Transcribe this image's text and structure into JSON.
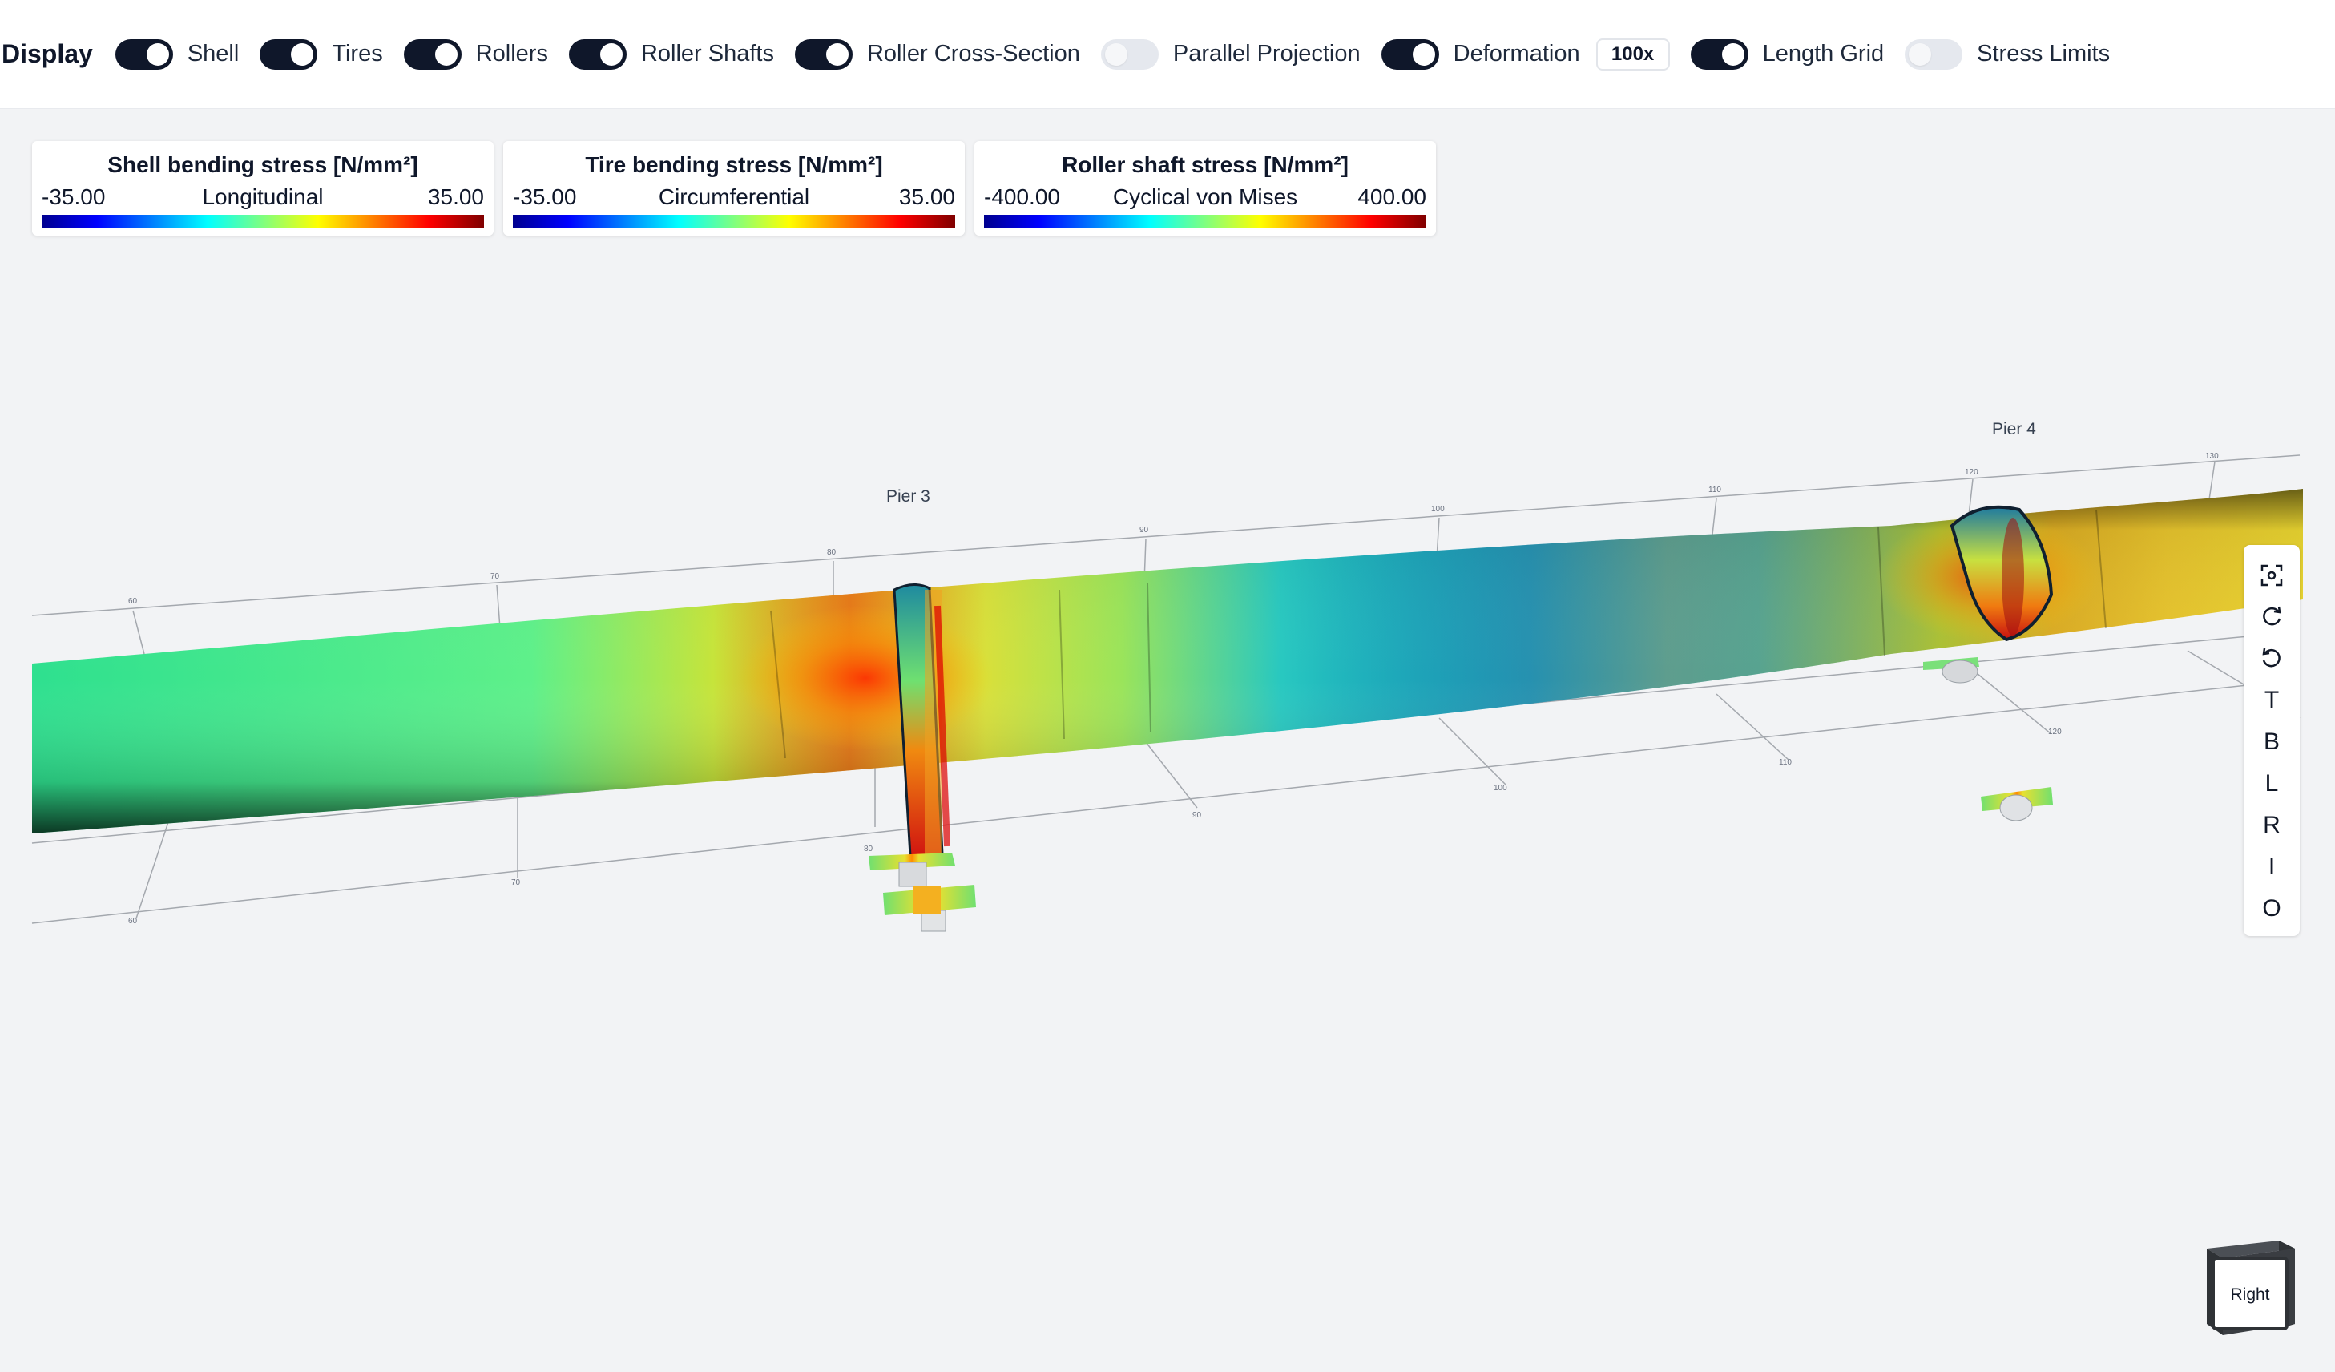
{
  "display": {
    "title": "Display",
    "toggles": [
      {
        "label": "Shell",
        "on": true
      },
      {
        "label": "Tires",
        "on": true
      },
      {
        "label": "Rollers",
        "on": true
      },
      {
        "label": "Roller Shafts",
        "on": true
      },
      {
        "label": "Roller Cross-Section",
        "on": true
      },
      {
        "label": "Parallel Projection",
        "on": false
      },
      {
        "label": "Deformation",
        "on": true
      },
      {
        "label": "Length Grid",
        "on": true
      },
      {
        "label": "Stress Limits",
        "on": false
      }
    ],
    "deformation_scale": "100x"
  },
  "legends": [
    {
      "title": "Shell bending stress [N/mm²]",
      "min": "-35.00",
      "mode": "Longitudinal",
      "max": "35.00"
    },
    {
      "title": "Tire bending stress [N/mm²]",
      "min": "-35.00",
      "mode": "Circumferential",
      "max": "35.00"
    },
    {
      "title": "Roller shaft stress [N/mm²]",
      "min": "-400.00",
      "mode": "Cyclical von Mises",
      "max": "400.00"
    }
  ],
  "scene": {
    "piers": [
      "Pier 3",
      "Pier 4"
    ],
    "grid_top_ticks": [
      "60",
      "70",
      "80",
      "90",
      "100",
      "110",
      "120",
      "130"
    ],
    "grid_bottom_ticks": [
      "60",
      "70",
      "80",
      "90",
      "100",
      "110",
      "120"
    ]
  },
  "view_toolbar": {
    "buttons": [
      {
        "name": "fit-view-icon",
        "label": ""
      },
      {
        "name": "rotate-cw-icon",
        "label": ""
      },
      {
        "name": "rotate-ccw-icon",
        "label": ""
      },
      {
        "name": "view-top",
        "label": "T"
      },
      {
        "name": "view-bottom",
        "label": "B"
      },
      {
        "name": "view-left",
        "label": "L"
      },
      {
        "name": "view-right",
        "label": "R"
      },
      {
        "name": "view-inlet",
        "label": "I"
      },
      {
        "name": "view-outlet",
        "label": "O"
      }
    ]
  },
  "view_cube": {
    "face": "Right"
  },
  "colors": {
    "toggle_on": "#0f172a",
    "toggle_off": "#e5e8ee",
    "background": "#f2f3f5"
  }
}
